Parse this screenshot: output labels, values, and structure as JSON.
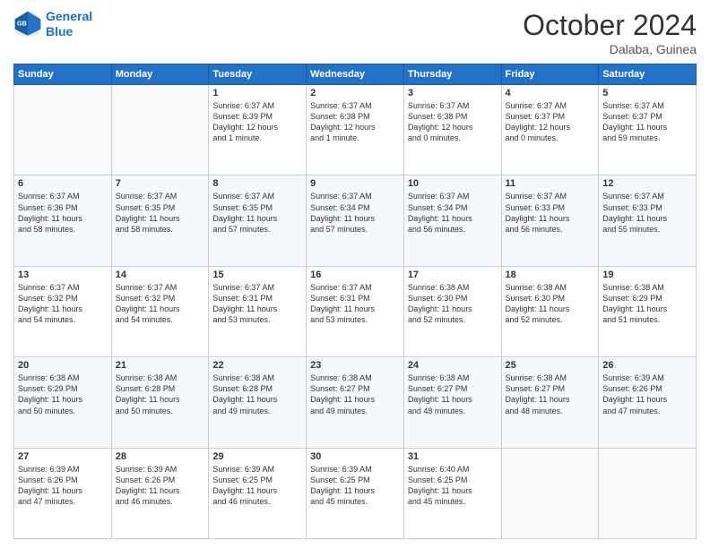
{
  "header": {
    "logo_line1": "General",
    "logo_line2": "Blue",
    "month": "October 2024",
    "location": "Dalaba, Guinea"
  },
  "days_of_week": [
    "Sunday",
    "Monday",
    "Tuesday",
    "Wednesday",
    "Thursday",
    "Friday",
    "Saturday"
  ],
  "weeks": [
    [
      {
        "day": "",
        "content": ""
      },
      {
        "day": "",
        "content": ""
      },
      {
        "day": "1",
        "content": "Sunrise: 6:37 AM\nSunset: 6:39 PM\nDaylight: 12 hours\nand 1 minute."
      },
      {
        "day": "2",
        "content": "Sunrise: 6:37 AM\nSunset: 6:38 PM\nDaylight: 12 hours\nand 1 minute."
      },
      {
        "day": "3",
        "content": "Sunrise: 6:37 AM\nSunset: 6:38 PM\nDaylight: 12 hours\nand 0 minutes."
      },
      {
        "day": "4",
        "content": "Sunrise: 6:37 AM\nSunset: 6:37 PM\nDaylight: 12 hours\nand 0 minutes."
      },
      {
        "day": "5",
        "content": "Sunrise: 6:37 AM\nSunset: 6:37 PM\nDaylight: 11 hours\nand 59 minutes."
      }
    ],
    [
      {
        "day": "6",
        "content": "Sunrise: 6:37 AM\nSunset: 6:36 PM\nDaylight: 11 hours\nand 58 minutes."
      },
      {
        "day": "7",
        "content": "Sunrise: 6:37 AM\nSunset: 6:35 PM\nDaylight: 11 hours\nand 58 minutes."
      },
      {
        "day": "8",
        "content": "Sunrise: 6:37 AM\nSunset: 6:35 PM\nDaylight: 11 hours\nand 57 minutes."
      },
      {
        "day": "9",
        "content": "Sunrise: 6:37 AM\nSunset: 6:34 PM\nDaylight: 11 hours\nand 57 minutes."
      },
      {
        "day": "10",
        "content": "Sunrise: 6:37 AM\nSunset: 6:34 PM\nDaylight: 11 hours\nand 56 minutes."
      },
      {
        "day": "11",
        "content": "Sunrise: 6:37 AM\nSunset: 6:33 PM\nDaylight: 11 hours\nand 56 minutes."
      },
      {
        "day": "12",
        "content": "Sunrise: 6:37 AM\nSunset: 6:33 PM\nDaylight: 11 hours\nand 55 minutes."
      }
    ],
    [
      {
        "day": "13",
        "content": "Sunrise: 6:37 AM\nSunset: 6:32 PM\nDaylight: 11 hours\nand 54 minutes."
      },
      {
        "day": "14",
        "content": "Sunrise: 6:37 AM\nSunset: 6:32 PM\nDaylight: 11 hours\nand 54 minutes."
      },
      {
        "day": "15",
        "content": "Sunrise: 6:37 AM\nSunset: 6:31 PM\nDaylight: 11 hours\nand 53 minutes."
      },
      {
        "day": "16",
        "content": "Sunrise: 6:37 AM\nSunset: 6:31 PM\nDaylight: 11 hours\nand 53 minutes."
      },
      {
        "day": "17",
        "content": "Sunrise: 6:38 AM\nSunset: 6:30 PM\nDaylight: 11 hours\nand 52 minutes."
      },
      {
        "day": "18",
        "content": "Sunrise: 6:38 AM\nSunset: 6:30 PM\nDaylight: 11 hours\nand 52 minutes."
      },
      {
        "day": "19",
        "content": "Sunrise: 6:38 AM\nSunset: 6:29 PM\nDaylight: 11 hours\nand 51 minutes."
      }
    ],
    [
      {
        "day": "20",
        "content": "Sunrise: 6:38 AM\nSunset: 6:29 PM\nDaylight: 11 hours\nand 50 minutes."
      },
      {
        "day": "21",
        "content": "Sunrise: 6:38 AM\nSunset: 6:28 PM\nDaylight: 11 hours\nand 50 minutes."
      },
      {
        "day": "22",
        "content": "Sunrise: 6:38 AM\nSunset: 6:28 PM\nDaylight: 11 hours\nand 49 minutes."
      },
      {
        "day": "23",
        "content": "Sunrise: 6:38 AM\nSunset: 6:27 PM\nDaylight: 11 hours\nand 49 minutes."
      },
      {
        "day": "24",
        "content": "Sunrise: 6:38 AM\nSunset: 6:27 PM\nDaylight: 11 hours\nand 48 minutes."
      },
      {
        "day": "25",
        "content": "Sunrise: 6:38 AM\nSunset: 6:27 PM\nDaylight: 11 hours\nand 48 minutes."
      },
      {
        "day": "26",
        "content": "Sunrise: 6:39 AM\nSunset: 6:26 PM\nDaylight: 11 hours\nand 47 minutes."
      }
    ],
    [
      {
        "day": "27",
        "content": "Sunrise: 6:39 AM\nSunset: 6:26 PM\nDaylight: 11 hours\nand 47 minutes."
      },
      {
        "day": "28",
        "content": "Sunrise: 6:39 AM\nSunset: 6:26 PM\nDaylight: 11 hours\nand 46 minutes."
      },
      {
        "day": "29",
        "content": "Sunrise: 6:39 AM\nSunset: 6:25 PM\nDaylight: 11 hours\nand 46 minutes."
      },
      {
        "day": "30",
        "content": "Sunrise: 6:39 AM\nSunset: 6:25 PM\nDaylight: 11 hours\nand 45 minutes."
      },
      {
        "day": "31",
        "content": "Sunrise: 6:40 AM\nSunset: 6:25 PM\nDaylight: 11 hours\nand 45 minutes."
      },
      {
        "day": "",
        "content": ""
      },
      {
        "day": "",
        "content": ""
      }
    ]
  ]
}
